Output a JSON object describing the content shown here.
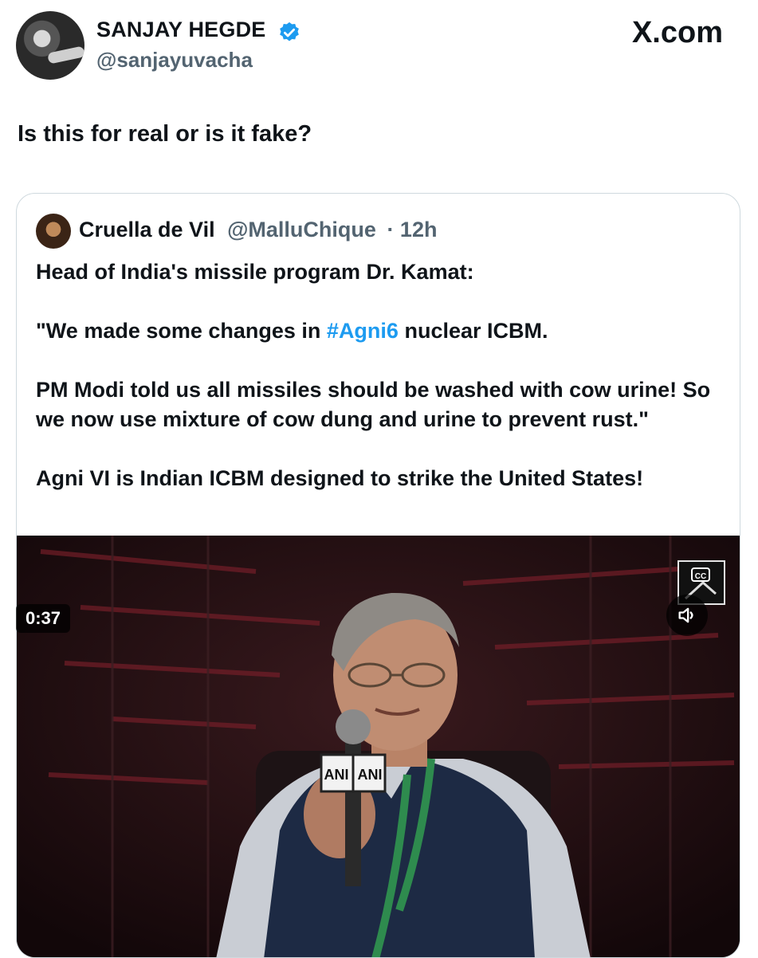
{
  "post": {
    "author_name": "SANJAY HEGDE",
    "author_handle": "@sanjayuvacha",
    "text": "Is this for real or is it fake?"
  },
  "brand": "X.com",
  "quoted": {
    "name": "Cruella de Vil",
    "handle": "@MalluChique",
    "time": "· 12h",
    "lines": [
      "Head of India's missile program Dr. Kamat:",
      "\"We made some changes in ",
      "#Agni6",
      " nuclear ICBM.",
      "PM Modi told us all missiles should be washed with cow urine! So we now use mixture of cow dung and urine to prevent rust.\"",
      "Agni VI is Indian ICBM designed to strike the United States!"
    ]
  },
  "video": {
    "duration": "0:37",
    "mic_label_left": "ANI",
    "mic_label_right": "ANI"
  },
  "colors": {
    "link": "#1d9bf0",
    "verified": "#1d9bf0",
    "muted_text": "#536471"
  },
  "icons": [
    "verified-badge-icon",
    "closed-captions-icon",
    "volume-icon"
  ]
}
